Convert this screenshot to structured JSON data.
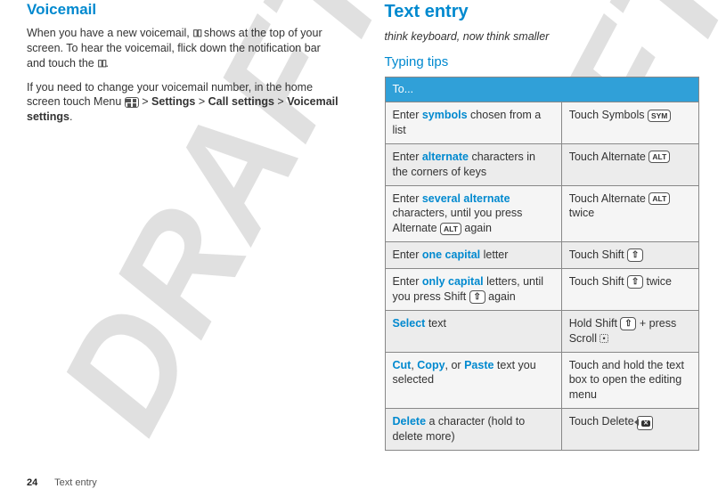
{
  "watermark": "DRAFT",
  "left": {
    "heading": "Voicemail",
    "para1_a": "When you have a new voicemail, ",
    "para1_b": " shows at the top of your screen. To hear the voicemail, flick down the notification bar and touch the ",
    "para1_c": ".",
    "para2_a": "If you need to change your voicemail number, in the home screen touch Menu ",
    "para2_b": " > ",
    "para2_strong1": "Settings",
    "para2_c": " > ",
    "para2_strong2": "Call settings",
    "para2_d": " > ",
    "para2_strong3": "Voicemail settings",
    "para2_e": "."
  },
  "right": {
    "heading": "Text entry",
    "subtitle": "think keyboard, now think smaller",
    "subhead": "Typing tips",
    "tableHeader": "To...",
    "rows": [
      {
        "left_a": "Enter ",
        "left_kw": "symbols",
        "left_b": " chosen from a list",
        "right_a": "Touch Symbols ",
        "icon": "SYM"
      },
      {
        "left_a": "Enter ",
        "left_kw": "alternate",
        "left_b": " characters in the corners of keys",
        "right_a": "Touch Alternate ",
        "icon": "ALT"
      },
      {
        "left_a": "Enter ",
        "left_kw": "several alternate",
        "left_b": " characters, until you press Alternate ",
        "left_icon": "ALT",
        "left_c": " again",
        "right_a": "Touch Alternate ",
        "icon": "ALT",
        "right_b": " twice"
      },
      {
        "left_a": "Enter ",
        "left_kw": "one capital",
        "left_b": " letter",
        "right_a": "Touch Shift ",
        "icon": "SHIFT"
      },
      {
        "left_a": "Enter ",
        "left_kw": "only capital",
        "left_b": " letters, until you press Shift ",
        "left_icon": "SHIFT",
        "left_c": " again",
        "right_a": "Touch Shift ",
        "icon": "SHIFT",
        "right_b": " twice"
      },
      {
        "left_kw": "Select",
        "left_b": " text",
        "right_a": "Hold Shift ",
        "icon": "SHIFT",
        "right_b": " + press Scroll ",
        "scroll": true
      },
      {
        "left_kw": "Cut",
        "left_sep1": ", ",
        "left_kw2": "Copy",
        "left_sep2": ", or ",
        "left_kw3": "Paste",
        "left_b": " text you selected",
        "right_a": "Touch and hold the text box to open the editing menu"
      },
      {
        "left_kw": "Delete",
        "left_b": " a character (hold to delete more)",
        "right_a": "Touch Delete ",
        "icon": "DELETE"
      }
    ]
  },
  "footer": {
    "page": "24",
    "chapter": "Text entry"
  }
}
